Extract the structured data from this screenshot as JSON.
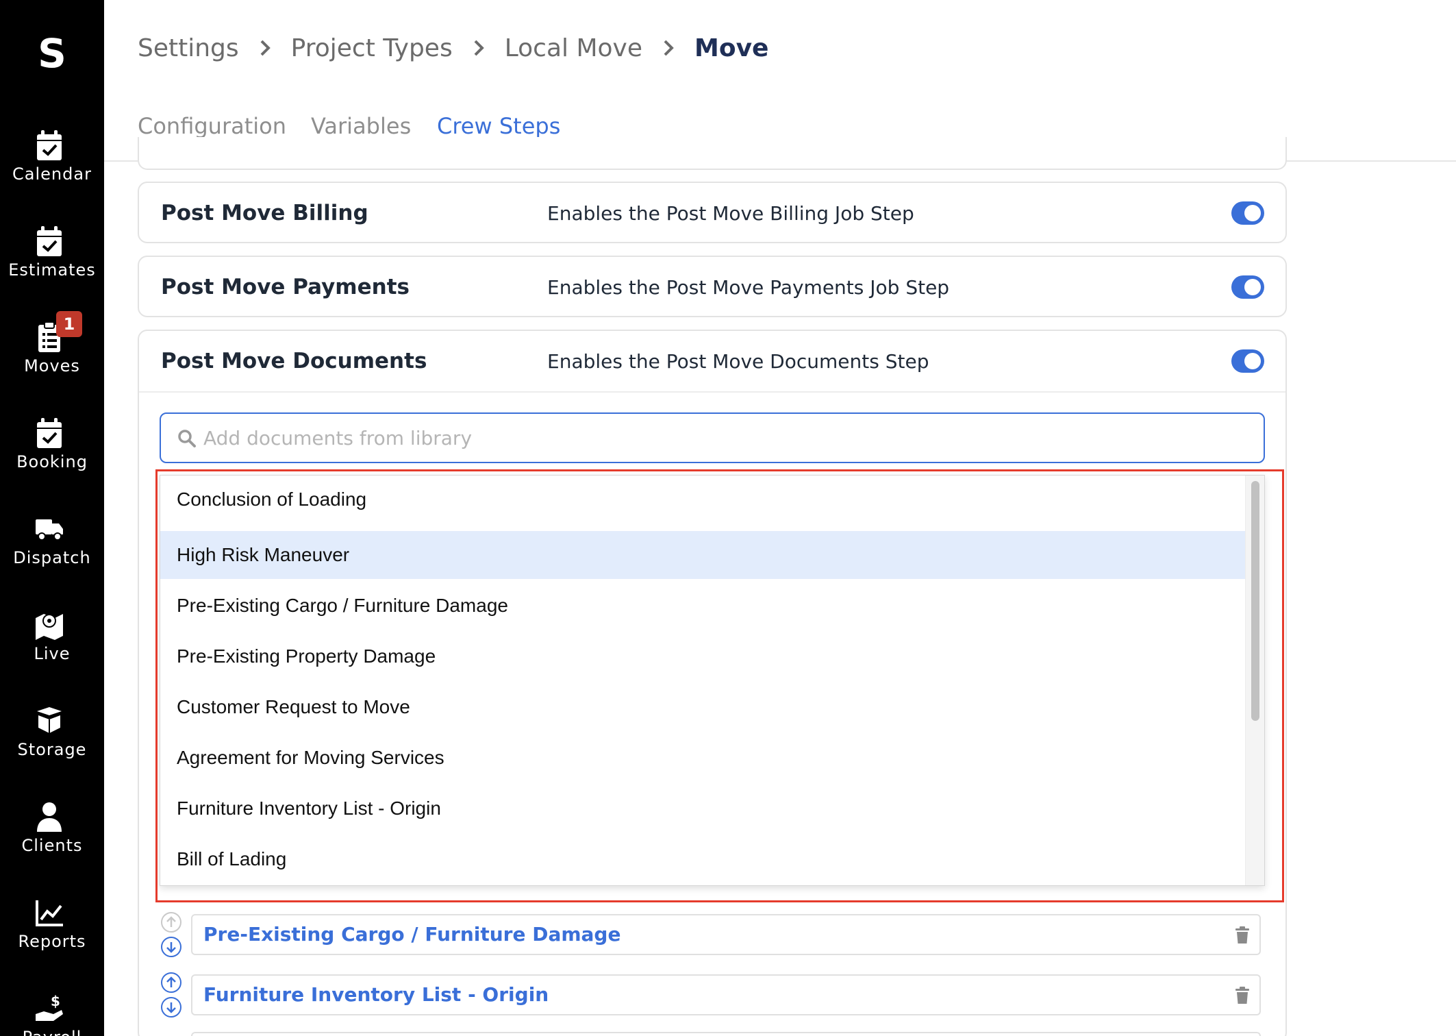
{
  "sidebar": {
    "logo": "S",
    "items": [
      {
        "label": "Calendar",
        "icon": "calendar-check-icon"
      },
      {
        "label": "Estimates",
        "icon": "calendar-check-icon"
      },
      {
        "label": "Moves",
        "icon": "clipboard-list-icon",
        "badge": "1"
      },
      {
        "label": "Booking",
        "icon": "calendar-check-icon"
      },
      {
        "label": "Dispatch",
        "icon": "truck-icon"
      },
      {
        "label": "Live",
        "icon": "map-marker-icon"
      },
      {
        "label": "Storage",
        "icon": "box-icon"
      },
      {
        "label": "Clients",
        "icon": "user-icon"
      },
      {
        "label": "Reports",
        "icon": "chart-line-icon"
      },
      {
        "label": "Payroll",
        "icon": "hand-dollar-icon"
      }
    ]
  },
  "breadcrumb": [
    "Settings",
    "Project Types",
    "Local Move",
    "Move"
  ],
  "tabs": [
    {
      "label": "Configuration",
      "active": false
    },
    {
      "label": "Variables",
      "active": false
    },
    {
      "label": "Crew Steps",
      "active": true
    }
  ],
  "steps": [
    {
      "title": "Post Move Billing",
      "description": "Enables the Post Move Billing Job Step",
      "enabled": true
    },
    {
      "title": "Post Move Payments",
      "description": "Enables the Post Move Payments Job Step",
      "enabled": true
    },
    {
      "title": "Post Move Documents",
      "description": "Enables the Post Move Documents Step",
      "enabled": true
    }
  ],
  "search": {
    "placeholder": "Add documents from library",
    "value": ""
  },
  "dropdown_options": [
    "Conclusion of Loading",
    "High Risk Maneuver",
    "Pre-Existing Cargo / Furniture Damage",
    "Pre-Existing Property Damage",
    "Customer Request to Move",
    "Agreement for Moving Services",
    "Furniture Inventory List - Origin",
    "Bill of Lading"
  ],
  "highlighted_option": "High Risk Maneuver",
  "selected_documents": [
    "Pre-Existing Cargo / Furniture Damage",
    "Furniture Inventory List - Origin"
  ],
  "colors": {
    "accent": "#3a6fd8",
    "sidebar_bg": "#000000",
    "badge": "#c0392b",
    "annotation": "#e53b2c",
    "highlight_row": "#e2ecfc"
  }
}
